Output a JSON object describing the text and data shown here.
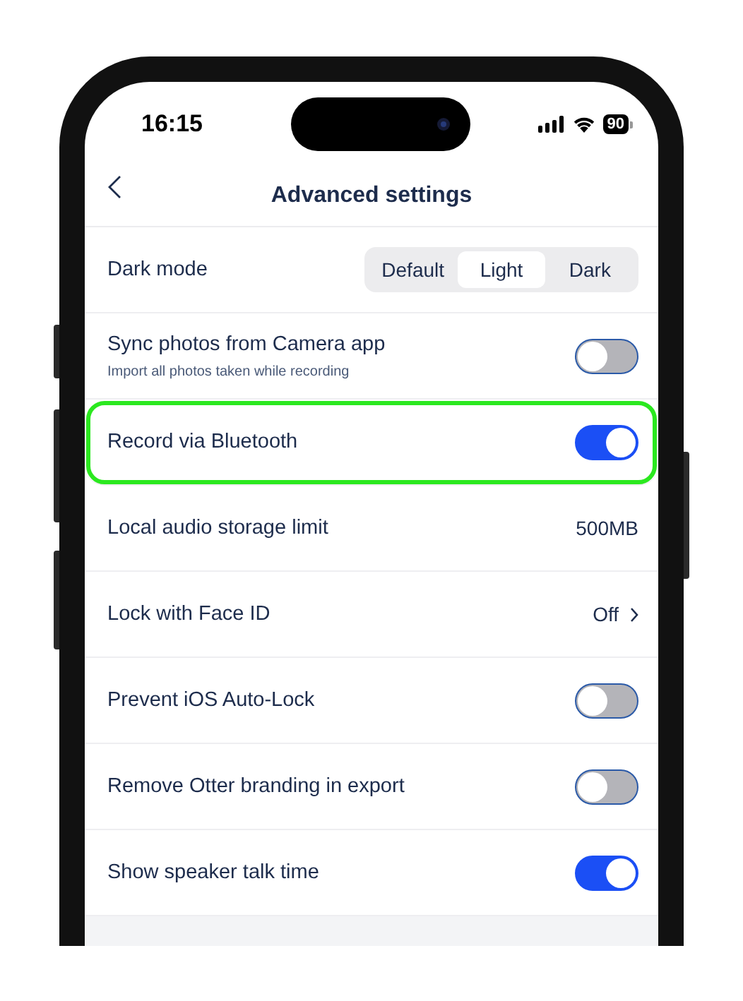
{
  "status_bar": {
    "time": "16:15",
    "battery": "90"
  },
  "header": {
    "title": "Advanced settings"
  },
  "settings": [
    {
      "kind": "segmented",
      "label": "Dark mode",
      "highlighted": false,
      "options": [
        {
          "label": "Default",
          "selected": false
        },
        {
          "label": "Light",
          "selected": true
        },
        {
          "label": "Dark",
          "selected": false
        }
      ]
    },
    {
      "kind": "toggle",
      "label": "Sync photos from Camera app",
      "subtitle": "Import all photos taken while recording",
      "on": false,
      "highlighted": false
    },
    {
      "kind": "toggle",
      "label": "Record via Bluetooth",
      "on": true,
      "highlighted": true
    },
    {
      "kind": "value",
      "label": "Local audio storage limit",
      "value": "500MB",
      "highlighted": false
    },
    {
      "kind": "link",
      "label": "Lock with Face ID",
      "value": "Off",
      "highlighted": false
    },
    {
      "kind": "toggle",
      "label": "Prevent iOS Auto-Lock",
      "on": false,
      "highlighted": false
    },
    {
      "kind": "toggle",
      "label": "Remove Otter branding in export",
      "on": false,
      "highlighted": false
    },
    {
      "kind": "toggle",
      "label": "Show speaker talk time",
      "on": true,
      "highlighted": false
    }
  ]
}
